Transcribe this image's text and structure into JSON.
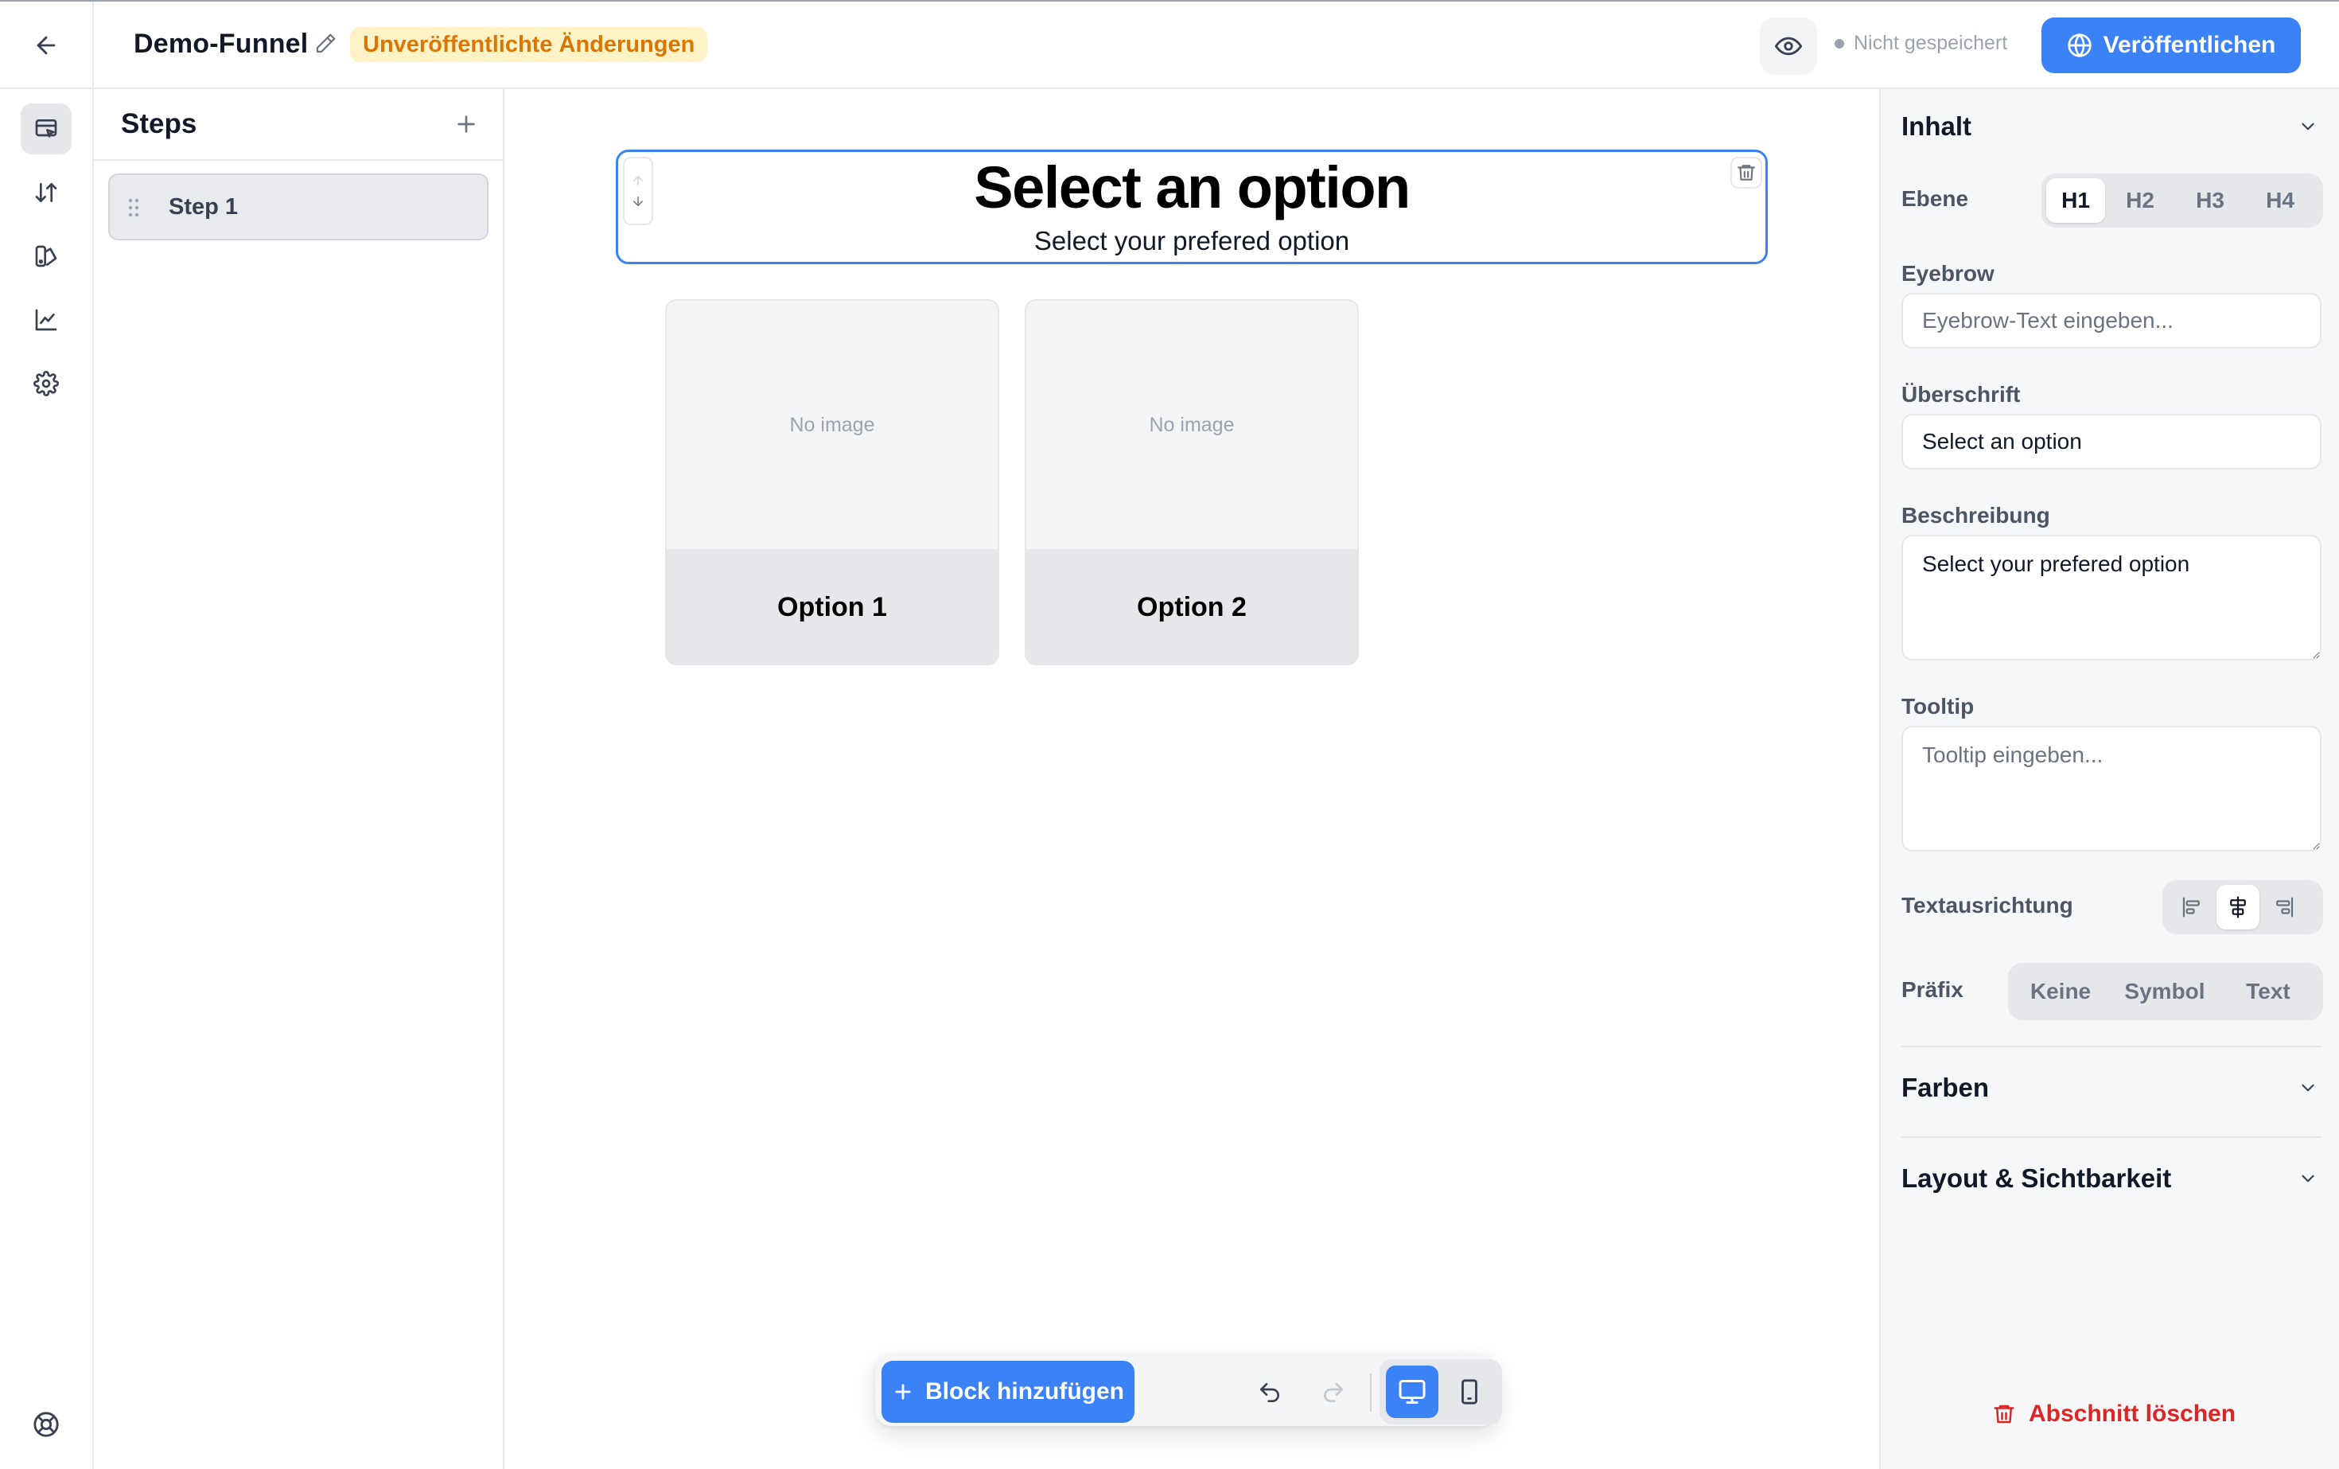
{
  "header": {
    "funnel_name": "Demo-Funnel",
    "unsaved_badge": "Unveröffentlichte Änderungen",
    "save_state": "Nicht gespeichert",
    "publish_label": "Veröffentlichen"
  },
  "rail": {
    "items": [
      "editor-icon",
      "sort-icon",
      "design-icon",
      "analytics-icon",
      "settings-icon"
    ],
    "active": "editor-icon",
    "bottom": "help-icon"
  },
  "steps": {
    "title": "Steps",
    "items": [
      {
        "label": "Step 1"
      }
    ]
  },
  "canvas": {
    "heading": {
      "title": "Select an option",
      "subtitle": "Select your prefered option"
    },
    "options": [
      {
        "image_text": "No image",
        "label": "Option 1"
      },
      {
        "image_text": "No image",
        "label": "Option 2"
      }
    ],
    "toolbar": {
      "add_block_label": "Block hinzufügen",
      "device": "desktop"
    }
  },
  "inspector": {
    "content_section": "Inhalt",
    "level": {
      "label": "Ebene",
      "options": [
        "H1",
        "H2",
        "H3",
        "H4"
      ],
      "selected": "H1"
    },
    "eyebrow": {
      "label": "Eyebrow",
      "placeholder": "Eyebrow-Text eingeben...",
      "value": ""
    },
    "heading": {
      "label": "Überschrift",
      "value": "Select an option"
    },
    "description": {
      "label": "Beschreibung",
      "value": "Select your prefered option"
    },
    "tooltip": {
      "label": "Tooltip",
      "placeholder": "Tooltip eingeben...",
      "value": ""
    },
    "text_align": {
      "label": "Textausrichtung",
      "options": [
        "left",
        "center",
        "right"
      ],
      "selected": "center"
    },
    "prefix": {
      "label": "Präfix",
      "options": [
        "Keine",
        "Symbol",
        "Text"
      ]
    },
    "colors_section": "Farben",
    "layout_section": "Layout & Sichtbarkeit",
    "delete_label": "Abschnitt löschen"
  },
  "colors": {
    "accent": "#3b82f6",
    "warning_bg": "#fef3c7",
    "warning_text": "#d97706",
    "danger": "#dc2626"
  }
}
